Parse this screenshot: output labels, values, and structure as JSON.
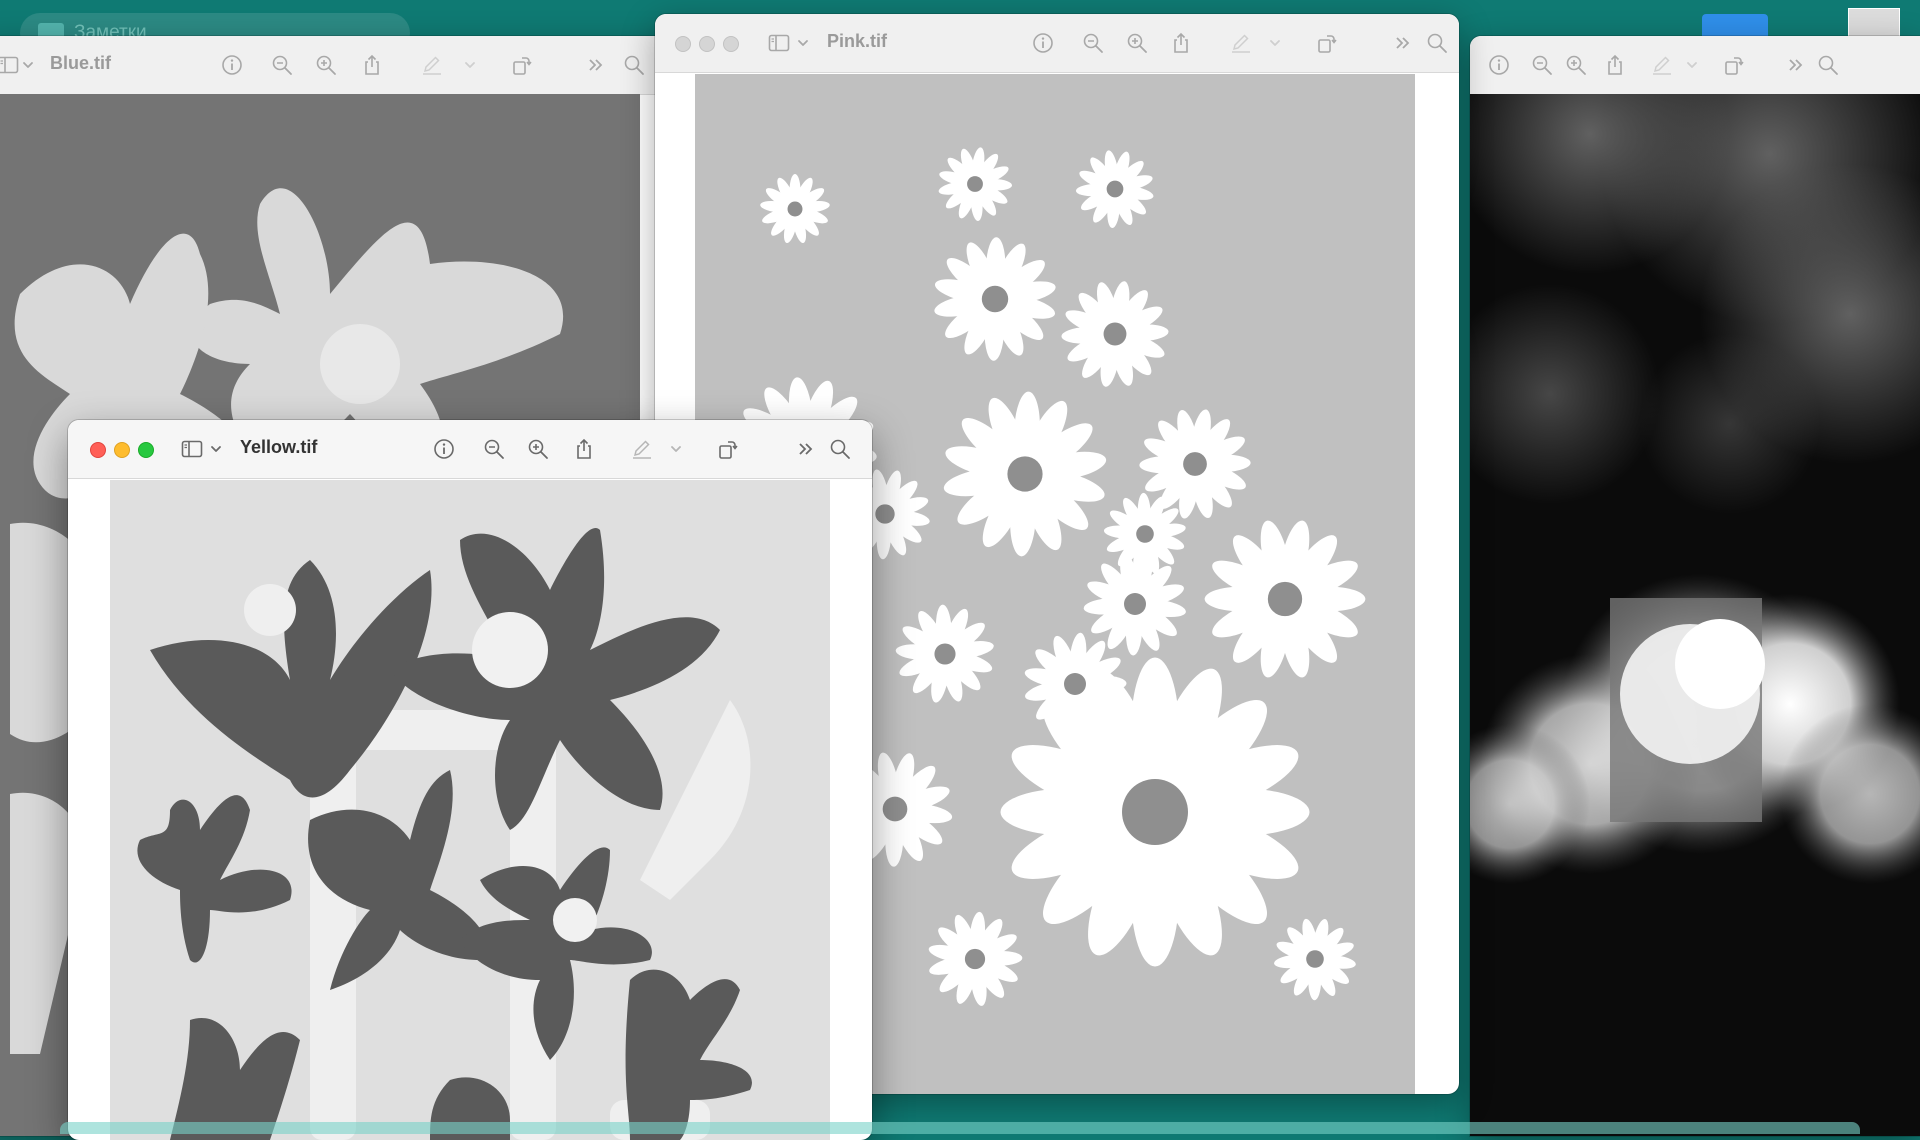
{
  "desktop": {
    "folder_label": "Заметки",
    "background_color": "#0f7a73"
  },
  "windows": {
    "blue": {
      "title": "Blue.tif"
    },
    "pink": {
      "title": "Pink.tif"
    },
    "yellow": {
      "title": "Yellow.tif"
    },
    "clouds": {
      "title": ""
    }
  },
  "toolbar_icons": [
    "sidebar-icon",
    "chevron-down-icon",
    "info-icon",
    "zoom-out-icon",
    "zoom-in-icon",
    "share-icon",
    "markup-pen-icon",
    "chevron-down-icon",
    "rotate-icon",
    "more-chevrons-icon",
    "search-icon"
  ]
}
